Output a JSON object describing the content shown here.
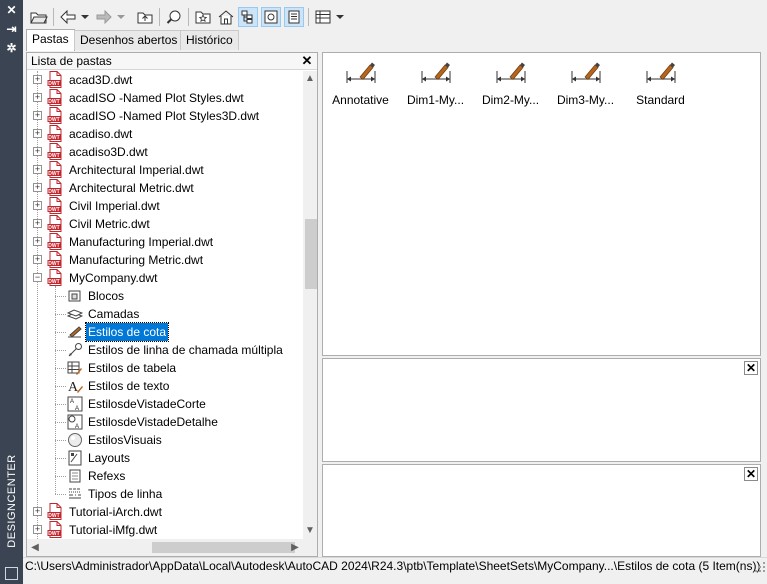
{
  "side": {
    "title": "DESIGNCENTER"
  },
  "tabs": [
    "Pastas",
    "Desenhos abertos",
    "Histórico"
  ],
  "tree": {
    "header": "Lista de pastas",
    "files": [
      "acad3D.dwt",
      "acadISO -Named Plot Styles.dwt",
      "acadISO -Named Plot Styles3D.dwt",
      "acadiso.dwt",
      "acadiso3D.dwt",
      "Architectural Imperial.dwt",
      "Architectural Metric.dwt",
      "Civil Imperial.dwt",
      "Civil Metric.dwt",
      "Manufacturing Imperial.dwt",
      "Manufacturing Metric.dwt",
      "MyCompany.dwt"
    ],
    "children": [
      {
        "label": "Blocos",
        "icon": "blocks-icon"
      },
      {
        "label": "Camadas",
        "icon": "layers-icon"
      },
      {
        "label": "Estilos de cota",
        "icon": "dimstyle-icon"
      },
      {
        "label": "Estilos de linha de chamada múltipla",
        "icon": "multileader-icon"
      },
      {
        "label": "Estilos de tabela",
        "icon": "table-style-icon"
      },
      {
        "label": "Estilos de texto",
        "icon": "text-style-icon"
      },
      {
        "label": "EstilosdeVistadeCorte",
        "icon": "section-view-icon"
      },
      {
        "label": "EstilosdeVistadeDetalhe",
        "icon": "detail-view-icon"
      },
      {
        "label": "EstilosVisuais",
        "icon": "visual-style-icon"
      },
      {
        "label": "Layouts",
        "icon": "layout-icon"
      },
      {
        "label": "Refexs",
        "icon": "xref-icon"
      },
      {
        "label": "Tipos de linha",
        "icon": "linetype-icon"
      }
    ],
    "after": [
      "Tutorial-iArch.dwt",
      "Tutorial-iMfg.dwt"
    ],
    "dwt_badge": "DWT",
    "selected_index": 2
  },
  "content": {
    "items": [
      "Annotative",
      "Dim1-My...",
      "Dim2-My...",
      "Dim3-My...",
      "Standard"
    ]
  },
  "status": {
    "path": "C:\\Users\\Administrador\\AppData\\Local\\Autodesk\\AutoCAD 2024\\R24.3\\ptb\\Template\\SheetSets\\MyCompany...\\Estilos de cota (5 Item(ns))"
  },
  "colors": {
    "side_bg": "#3b4453",
    "selection": "#0078d7",
    "dwt_red": "#c0262d"
  }
}
